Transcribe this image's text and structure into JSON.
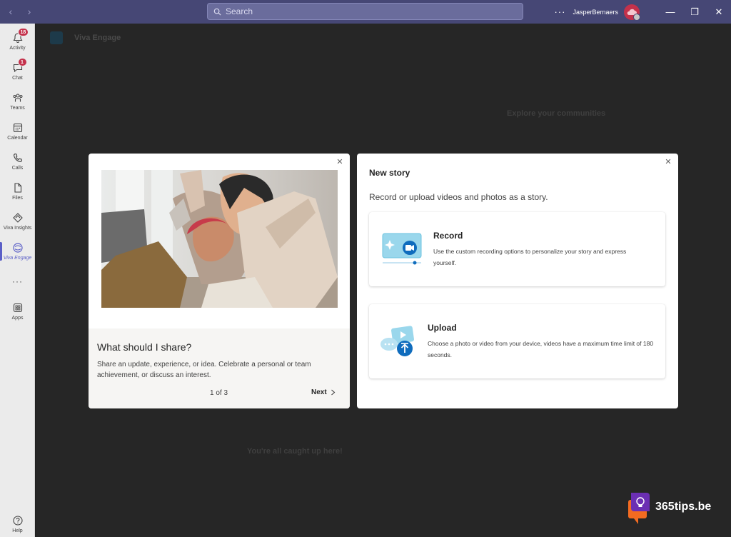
{
  "titlebar": {
    "search_placeholder": "Search",
    "more": "···",
    "user_name": "JasperBernaers",
    "minimize": "—",
    "maximize": "❐",
    "close": "✕"
  },
  "rail": {
    "items": [
      {
        "label": "Activity",
        "badge": "18",
        "icon": "bell-icon"
      },
      {
        "label": "Chat",
        "badge": "1",
        "icon": "chat-icon"
      },
      {
        "label": "Teams",
        "icon": "teams-icon"
      },
      {
        "label": "Calendar",
        "icon": "calendar-icon"
      },
      {
        "label": "Calls",
        "icon": "phone-icon"
      },
      {
        "label": "Files",
        "icon": "file-icon"
      },
      {
        "label": "Viva Insights",
        "icon": "insights-icon"
      },
      {
        "label": "Viva Engage",
        "icon": "engage-icon",
        "active": true
      },
      {
        "label": "···",
        "icon": "more-icon"
      },
      {
        "label": "Apps",
        "icon": "apps-icon"
      },
      {
        "label": "Help",
        "icon": "help-icon"
      }
    ]
  },
  "background": {
    "app_title": "Viva Engage",
    "caught_up": "You're all caught up here!",
    "right_heading": "Explore your communities"
  },
  "left_card": {
    "close": "✕",
    "title": "What should I share?",
    "description": "Share an update, experience, or idea. Celebrate a personal or team achievement, or discuss an interest.",
    "pager": "1 of 3",
    "next_label": "Next"
  },
  "right_card": {
    "close": "✕",
    "title": "New story",
    "subtitle": "Record or upload videos and photos as a story.",
    "options": [
      {
        "title": "Record",
        "description": "Use the custom recording options to personalize your story and express yourself."
      },
      {
        "title": "Upload",
        "description": "Choose a photo or video from your device, videos have a maximum time limit of 180 seconds."
      }
    ]
  },
  "watermark": {
    "text": "365tips.be"
  },
  "colors": {
    "titlebar": "#464775",
    "accent": "#5b5fc7",
    "badge": "#c4314b",
    "watermark_orange": "#f36b21",
    "watermark_purple": "#6b2fb3"
  }
}
